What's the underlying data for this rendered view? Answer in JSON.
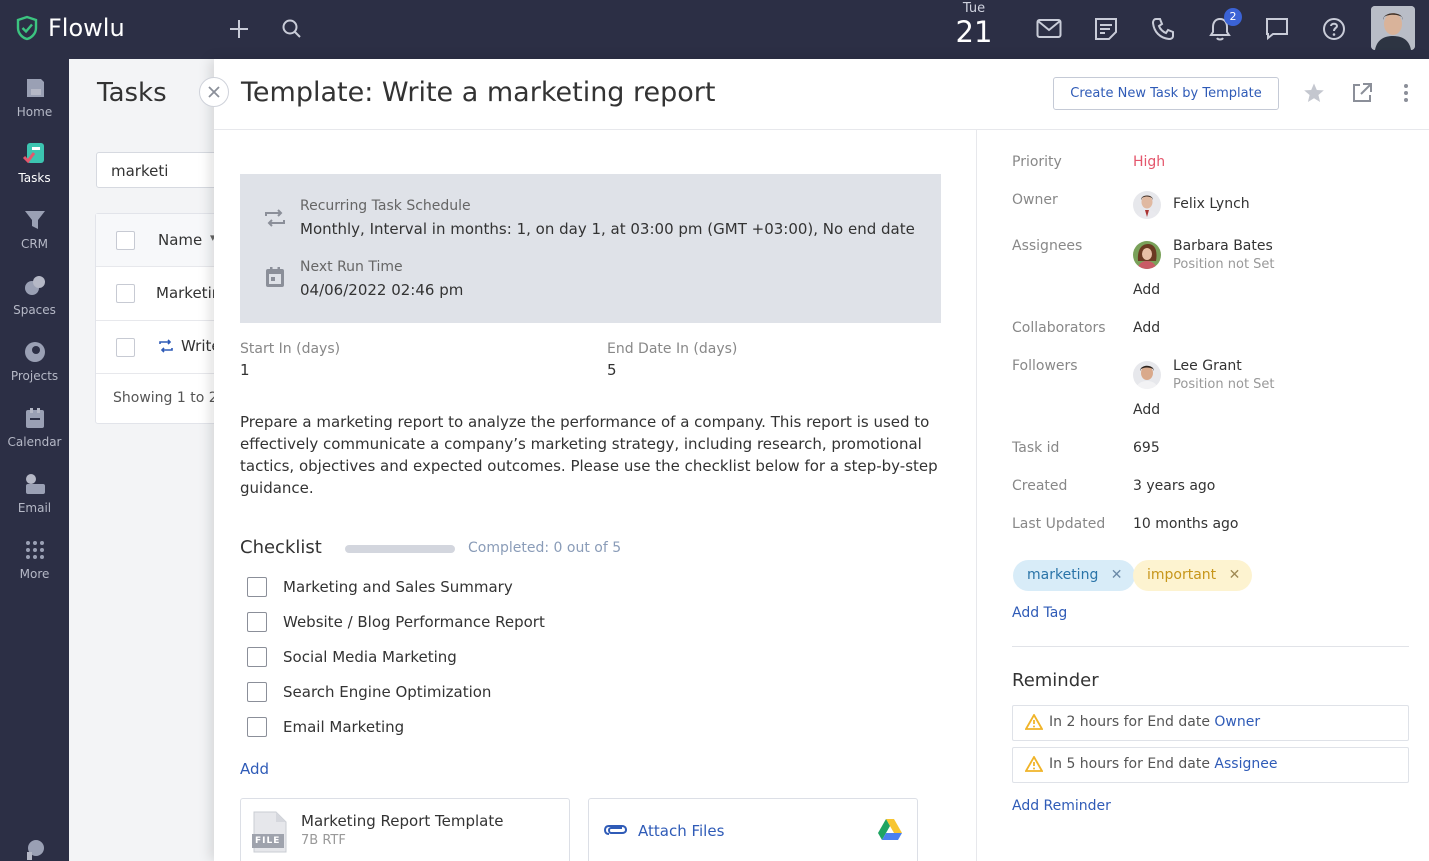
{
  "app": {
    "name": "Flowlu"
  },
  "topbar": {
    "date_day": "Tue",
    "date_num": "21",
    "notification_count": "2"
  },
  "nav": [
    {
      "label": "Home",
      "icon": "home-icon"
    },
    {
      "label": "Tasks",
      "icon": "tasks-icon"
    },
    {
      "label": "CRM",
      "icon": "crm-icon"
    },
    {
      "label": "Spaces",
      "icon": "spaces-icon"
    },
    {
      "label": "Projects",
      "icon": "projects-icon"
    },
    {
      "label": "Calendar",
      "icon": "calendar-icon"
    },
    {
      "label": "Email",
      "icon": "email-icon"
    },
    {
      "label": "More",
      "icon": "more-icon"
    }
  ],
  "background": {
    "title": "Tasks",
    "search_value": "marketi",
    "column_name": "Name",
    "rows": [
      "Marketir",
      "Write"
    ],
    "footer": "Showing 1 to 2"
  },
  "panel": {
    "title": "Template: Write a marketing report",
    "create_button": "Create New Task by Template",
    "schedule": {
      "recurring_label": "Recurring Task Schedule",
      "recurring_value": "Monthly, Interval in months: 1, on day 1, at 03:00 pm (GMT +03:00), No end date",
      "next_label": "Next Run Time",
      "next_value": "04/06/2022 02:46 pm"
    },
    "start_label": "Start In (days)",
    "start_value": "1",
    "end_label": "End Date In (days)",
    "end_value": "5",
    "description": "Prepare a marketing report to analyze the performance of a company. This report is used to effectively communicate a company’s marketing strategy, including research, promotional tactics, objectives and expected outcomes. Please use the checklist below for a step-by-step guidance.",
    "checklist": {
      "title": "Checklist",
      "completed_text": "Completed: 0 out of 5",
      "progress": 0,
      "items": [
        "Marketing and Sales Summary",
        "Website / Blog Performance Report",
        "Social Media Marketing",
        "Search Engine Optimization",
        "Email Marketing"
      ],
      "add_label": "Add"
    },
    "file": {
      "name": "Marketing Report Template",
      "meta": "7B RTF",
      "icon_text": "FILE"
    },
    "attach_label": "Attach Files"
  },
  "sidebar": {
    "priority_label": "Priority",
    "priority_value": "High",
    "owner_label": "Owner",
    "owner_name": "Felix Lynch",
    "assignees_label": "Assignees",
    "assignee_name": "Barbara Bates",
    "assignee_position": "Position not Set",
    "add_label": "Add",
    "collaborators_label": "Collaborators",
    "followers_label": "Followers",
    "follower_name": "Lee Grant",
    "follower_position": "Position not Set",
    "task_id_label": "Task id",
    "task_id_value": "695",
    "created_label": "Created",
    "created_value": "3 years ago",
    "updated_label": "Last Updated",
    "updated_value": "10 months ago",
    "tags": [
      "marketing",
      "important"
    ],
    "add_tag_label": "Add Tag",
    "reminder_title": "Reminder",
    "reminders": [
      {
        "text": "In 2 hours for End date",
        "target": "Owner"
      },
      {
        "text": "In 5 hours for End date",
        "target": "Assignee"
      }
    ],
    "add_reminder_label": "Add Reminder"
  },
  "colors": {
    "topbar": "#2c2f45",
    "accent": "#2f5bb7",
    "priority_high": "#e4566c",
    "tag_marketing_bg": "#d8ecf8",
    "tag_important_bg": "#fdf3d0"
  }
}
